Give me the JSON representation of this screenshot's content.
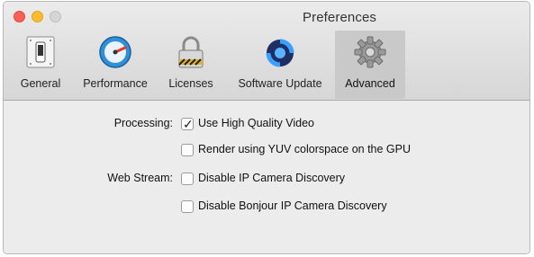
{
  "window": {
    "title": "Preferences"
  },
  "toolbar": {
    "items": [
      {
        "label": "General",
        "icon": "switch-icon"
      },
      {
        "label": "Performance",
        "icon": "speedometer-icon"
      },
      {
        "label": "Licenses",
        "icon": "padlock-icon"
      },
      {
        "label": "Software Update",
        "icon": "sync-icon"
      },
      {
        "label": "Advanced",
        "icon": "gear-icon",
        "selected": true
      }
    ]
  },
  "settings": {
    "processing_label": "Processing:",
    "web_stream_label": "Web Stream:",
    "options": [
      {
        "label": "Use High Quality Video",
        "checked": true
      },
      {
        "label": "Render using YUV colorspace on the GPU",
        "checked": false
      },
      {
        "label": "Disable IP Camera Discovery",
        "checked": false
      },
      {
        "label": "Disable Bonjour IP Camera Discovery",
        "checked": false
      }
    ]
  },
  "colors": {
    "close": "#fc5f57",
    "minimize": "#fdbc2e",
    "maximize": "#d5d5d5",
    "selected_tab": "#c9c9c9"
  }
}
